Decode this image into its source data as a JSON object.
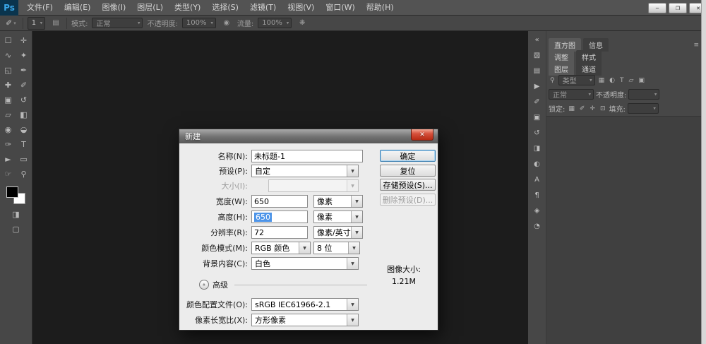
{
  "glyphs": {
    "arrow": "▼",
    "small_arrow": "▾",
    "chevrons": "»",
    "menu": "≡",
    "search": "⚲"
  },
  "window": {
    "logo": "Ps",
    "minimize": "─",
    "maximize": "❐",
    "close": "✕"
  },
  "menubar": {
    "items": [
      "文件(F)",
      "编辑(E)",
      "图像(I)",
      "图层(L)",
      "类型(Y)",
      "选择(S)",
      "滤镜(T)",
      "视图(V)",
      "窗口(W)",
      "帮助(H)"
    ]
  },
  "optionsbar": {
    "tool_glyph": "✐",
    "brush_size": "1",
    "brush_panel_glyph": "▤",
    "mode_label": "模式:",
    "mode_value": "正常",
    "opacity_label": "不透明度:",
    "opacity_value": "100%",
    "pressure_glyph": "◉",
    "flow_label": "流量:",
    "flow_value": "100%",
    "airbrush_glyph": "❋"
  },
  "toolbar": {
    "tools": [
      {
        "name": "rectangular-marquee-tool",
        "glyph": "☐"
      },
      {
        "name": "move-tool",
        "glyph": "✛"
      },
      {
        "name": "lasso-tool",
        "glyph": "∿"
      },
      {
        "name": "quick-selection-tool",
        "glyph": "✦"
      },
      {
        "name": "crop-tool",
        "glyph": "◱"
      },
      {
        "name": "eyedropper-tool",
        "glyph": "✒"
      },
      {
        "name": "healing-brush-tool",
        "glyph": "✚"
      },
      {
        "name": "brush-tool",
        "glyph": "✐"
      },
      {
        "name": "clone-stamp-tool",
        "glyph": "▣"
      },
      {
        "name": "history-brush-tool",
        "glyph": "↺"
      },
      {
        "name": "eraser-tool",
        "glyph": "▱"
      },
      {
        "name": "gradient-tool",
        "glyph": "◧"
      },
      {
        "name": "blur-tool",
        "glyph": "◉"
      },
      {
        "name": "dodge-tool",
        "glyph": "◒"
      },
      {
        "name": "pen-tool",
        "glyph": "✑"
      },
      {
        "name": "type-tool",
        "glyph": "T"
      },
      {
        "name": "path-selection-tool",
        "glyph": "►"
      },
      {
        "name": "shape-tool",
        "glyph": "▭"
      },
      {
        "name": "hand-tool",
        "glyph": "☞"
      },
      {
        "name": "zoom-tool",
        "glyph": "⚲"
      }
    ],
    "quick_mask_glyph": "◨",
    "screen_mode_glyph": "▢"
  },
  "strip": {
    "icons": [
      {
        "name": "expand-panels-icon",
        "glyph": "«"
      },
      {
        "name": "color-panel-icon",
        "glyph": "▧"
      },
      {
        "name": "swatches-panel-icon",
        "glyph": "▤"
      },
      {
        "name": "actions-panel-icon",
        "glyph": "▶"
      },
      {
        "name": "brush-presets-panel-icon",
        "glyph": "✐"
      },
      {
        "name": "clone-source-panel-icon",
        "glyph": "▣"
      },
      {
        "name": "history-panel-icon",
        "glyph": "↺"
      },
      {
        "name": "properties-panel-icon",
        "glyph": "◨"
      },
      {
        "name": "masks-panel-icon",
        "glyph": "◐"
      },
      {
        "name": "character-panel-icon",
        "glyph": "A"
      },
      {
        "name": "paragraph-panel-icon",
        "glyph": "¶"
      },
      {
        "name": "navigator-panel-icon",
        "glyph": "◈"
      },
      {
        "name": "timeline-panel-icon",
        "glyph": "◔"
      }
    ]
  },
  "panels": {
    "tab_histogram": "直方图",
    "tab_info": "信息",
    "tab_adjustments": "调整",
    "tab_styles": "样式",
    "tab_layers": "图层",
    "tab_channels": "通道",
    "filter_type_label": "类型",
    "filter_icons": [
      {
        "name": "pixel-layer-filter-icon",
        "glyph": "▦"
      },
      {
        "name": "adjustment-layer-filter-icon",
        "glyph": "◐"
      },
      {
        "name": "type-layer-filter-icon",
        "glyph": "T"
      },
      {
        "name": "shape-layer-filter-icon",
        "glyph": "▱"
      },
      {
        "name": "smart-object-filter-icon",
        "glyph": "▣"
      }
    ],
    "blend_mode": "正常",
    "opacity_label": "不透明度:",
    "opacity_value": "",
    "lock_label": "锁定:",
    "lock_icons": [
      {
        "name": "lock-transparent-pixels-icon",
        "glyph": "▦"
      },
      {
        "name": "lock-image-pixels-icon",
        "glyph": "✐"
      },
      {
        "name": "lock-position-icon",
        "glyph": "✛"
      },
      {
        "name": "lock-all-icon",
        "glyph": "⊡"
      }
    ],
    "fill_label": "填充:",
    "fill_value": ""
  },
  "dialog": {
    "title": "新建",
    "name_label": "名称(N):",
    "name_value": "未标题-1",
    "preset_label": "预设(P):",
    "preset_value": "自定",
    "size_label": "大小(I):",
    "size_value": "",
    "width_label": "宽度(W):",
    "width_value": "650",
    "width_unit": "像素",
    "height_label": "高度(H):",
    "height_value": "650",
    "height_unit": "像素",
    "resolution_label": "分辨率(R):",
    "resolution_value": "72",
    "resolution_unit": "像素/英寸",
    "mode_label": "颜色模式(M):",
    "mode_value": "RGB 颜色",
    "bit_value": "8 位",
    "background_label": "背景内容(C):",
    "background_value": "白色",
    "advanced_label": "高级",
    "profile_label": "颜色配置文件(O):",
    "profile_value": "sRGB IEC61966-2.1",
    "aspect_label": "像素长宽比(X):",
    "aspect_value": "方形像素",
    "ok_label": "确定",
    "reset_label": "复位",
    "save_preset_label": "存储预设(S)...",
    "delete_preset_label": "删除预设(D)...",
    "image_size_label": "图像大小:",
    "image_size_value": "1.21M"
  }
}
